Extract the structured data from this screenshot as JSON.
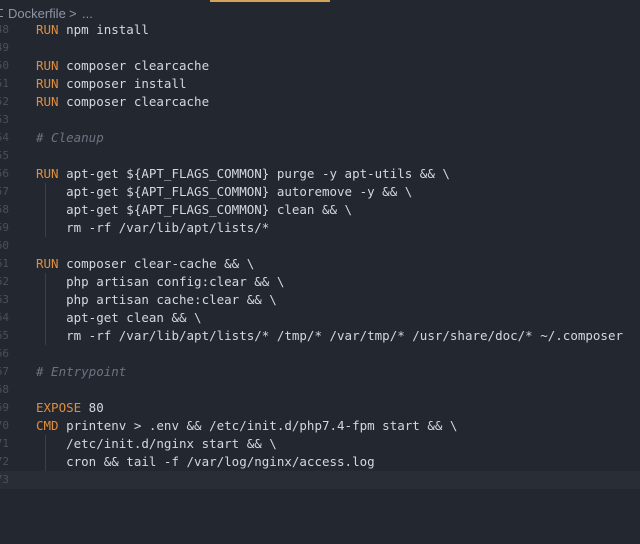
{
  "breadcrumb": {
    "file": "Dockerfile",
    "separator": ">",
    "more": "..."
  },
  "lines": [
    {
      "num": "48",
      "tokens": [
        {
          "t": "RUN",
          "c": "kw"
        },
        {
          "t": " npm install"
        }
      ]
    },
    {
      "num": "49",
      "tokens": []
    },
    {
      "num": "50",
      "tokens": [
        {
          "t": "RUN",
          "c": "kw"
        },
        {
          "t": " composer clearcache"
        }
      ]
    },
    {
      "num": "51",
      "tokens": [
        {
          "t": "RUN",
          "c": "kw"
        },
        {
          "t": " composer install"
        }
      ]
    },
    {
      "num": "52",
      "tokens": [
        {
          "t": "RUN",
          "c": "kw"
        },
        {
          "t": " composer clearcache"
        }
      ]
    },
    {
      "num": "53",
      "tokens": []
    },
    {
      "num": "54",
      "tokens": [
        {
          "t": "# Cleanup",
          "c": "cm"
        }
      ]
    },
    {
      "num": "55",
      "tokens": []
    },
    {
      "num": "56",
      "tokens": [
        {
          "t": "RUN",
          "c": "kw"
        },
        {
          "t": " apt-get ${APT_FLAGS_COMMON} purge -y apt-utils && \\"
        }
      ]
    },
    {
      "num": "57",
      "tokens": [
        {
          "t": "    apt-get ${APT_FLAGS_COMMON} autoremove -y && \\"
        }
      ]
    },
    {
      "num": "58",
      "tokens": [
        {
          "t": "    apt-get ${APT_FLAGS_COMMON} clean && \\"
        }
      ]
    },
    {
      "num": "59",
      "tokens": [
        {
          "t": "    rm -rf /var/lib/apt/lists/*"
        }
      ]
    },
    {
      "num": "60",
      "tokens": []
    },
    {
      "num": "61",
      "tokens": [
        {
          "t": "RUN",
          "c": "kw"
        },
        {
          "t": " composer clear-cache && \\"
        }
      ]
    },
    {
      "num": "62",
      "tokens": [
        {
          "t": "    php artisan config:clear && \\"
        }
      ]
    },
    {
      "num": "63",
      "tokens": [
        {
          "t": "    php artisan cache:clear && \\"
        }
      ]
    },
    {
      "num": "64",
      "tokens": [
        {
          "t": "    apt-get clean && \\"
        }
      ]
    },
    {
      "num": "65",
      "tokens": [
        {
          "t": "    rm -rf /var/lib/apt/lists/* /tmp/* /var/tmp/* /usr/share/doc/* ~/.composer"
        }
      ]
    },
    {
      "num": "66",
      "tokens": []
    },
    {
      "num": "67",
      "tokens": [
        {
          "t": "# Entrypoint",
          "c": "cm"
        }
      ]
    },
    {
      "num": "68",
      "tokens": []
    },
    {
      "num": "69",
      "tokens": [
        {
          "t": "EXPOSE",
          "c": "kw"
        },
        {
          "t": " 80"
        }
      ]
    },
    {
      "num": "70",
      "tokens": [
        {
          "t": "CMD",
          "c": "kw"
        },
        {
          "t": " printenv > .env && /etc/init.d/php7.4-fpm start && \\"
        }
      ]
    },
    {
      "num": "71",
      "tokens": [
        {
          "t": "    /etc/init.d/nginx start && \\"
        }
      ]
    },
    {
      "num": "72",
      "tokens": [
        {
          "t": "    cron && tail -f /var/log/nginx/access.log"
        }
      ]
    },
    {
      "num": "73",
      "tokens": [],
      "current": true
    }
  ],
  "colors": {
    "background": "#232730",
    "keyword": "#e28c3c",
    "comment": "#6c7382",
    "text": "#d3d7de",
    "accent": "#d4a35a"
  }
}
